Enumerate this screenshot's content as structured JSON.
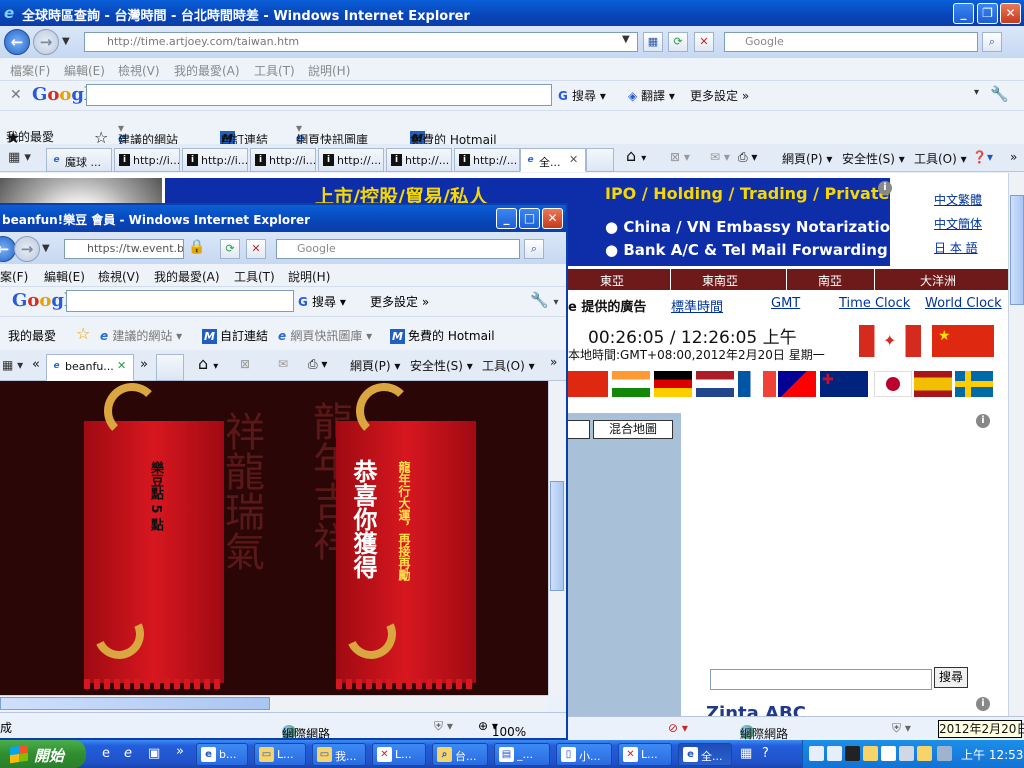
{
  "main_window": {
    "title": "全球時區查詢 - 台灣時間 - 台北時間時差 - Windows Internet Explorer",
    "address": "http://time.artjoey.com/taiwan.htm",
    "search_placeholder": "Google",
    "menu": [
      "檔案(F)",
      "編輯(E)",
      "檢視(V)",
      "我的最愛(A)",
      "工具(T)",
      "說明(H)"
    ],
    "google_toolbar": {
      "logo": "Google",
      "search_label": "搜尋",
      "translate_label": "翻譯",
      "more_label": "更多設定 »"
    },
    "favorites_bar": {
      "favorites": "我的最愛",
      "suggested_sites": "建議的網站",
      "custom_links": "自訂連結",
      "web_slice_gallery": "網頁快訊圖庫",
      "hotmail": "免費的 Hotmail"
    },
    "tabs": [
      "魔球 ...",
      "http://i...",
      "http://i...",
      "http://i...",
      "http://...",
      "http://...",
      "http://...",
      "全..."
    ],
    "commands": {
      "page": "網頁(P)",
      "safety": "安全性(S)",
      "tools": "工具(O)"
    },
    "status": {
      "zone": "網際網路"
    }
  },
  "page": {
    "banner_cn": "上市/控股/貿易/私人",
    "banner_en": "IPO / Holding / Trading / Private",
    "banner_line1": "China / VN Embassy Notarization",
    "banner_line2": "Bank A/C & Tel Mail Forwarding",
    "lang_links": [
      "中文繁體",
      "中文簡体",
      "日 本 語"
    ],
    "regions": [
      "東亞",
      "東南亞",
      "南亞",
      "大洋洲"
    ],
    "nav_links": [
      "e 提供的廣告",
      "標準時間",
      "GMT",
      "Time Clock",
      "World Clock"
    ],
    "time_display": "00:26:05 / 12:26:05 上午",
    "local_time": "本地時間:GMT+08:00,2012年2月20日 星期一",
    "map_button": "混合地圖",
    "search_button": "搜尋",
    "footer_partial": "Zinta ABC"
  },
  "popup": {
    "title": "beanfun!樂豆 會員 - Windows Internet Explorer",
    "address": "https://tw.event.b",
    "search_placeholder": "Google",
    "menu": [
      "案(F)",
      "編輯(E)",
      "檢視(V)",
      "我的最愛(A)",
      "工具(T)",
      "說明(H)"
    ],
    "google_logo": "Google",
    "search_label": "搜尋",
    "more_label": "更多設定 »",
    "favorites": "我的最愛",
    "suggested_sites": "建議的網站",
    "custom_links": "自訂連結",
    "web_slice_gallery": "網頁快訊圖庫",
    "hotmail": "免費的 Hotmail",
    "tab_label": "beanfu...",
    "commands": {
      "page": "網頁(P)",
      "safety": "安全性(S)",
      "tools": "工具(O)"
    },
    "ticket_left": "樂豆點 5 點",
    "ticket_right_main": "恭喜你獲得",
    "ticket_right_side": "龍年行大運，再接再勵",
    "bg_left": "祥龍瑞氣",
    "bg_right": "龍年吉祥",
    "status_zone": "網際網路",
    "status_left": "成",
    "zoom": "100%"
  },
  "taskbar": {
    "start": "開始",
    "buttons": [
      "b...",
      "L...",
      "我...",
      "L...",
      "台...",
      "_...",
      "小...",
      "L...",
      "全..."
    ],
    "clock": "上午 12:53",
    "date_tooltip": "2012年2月20日"
  }
}
